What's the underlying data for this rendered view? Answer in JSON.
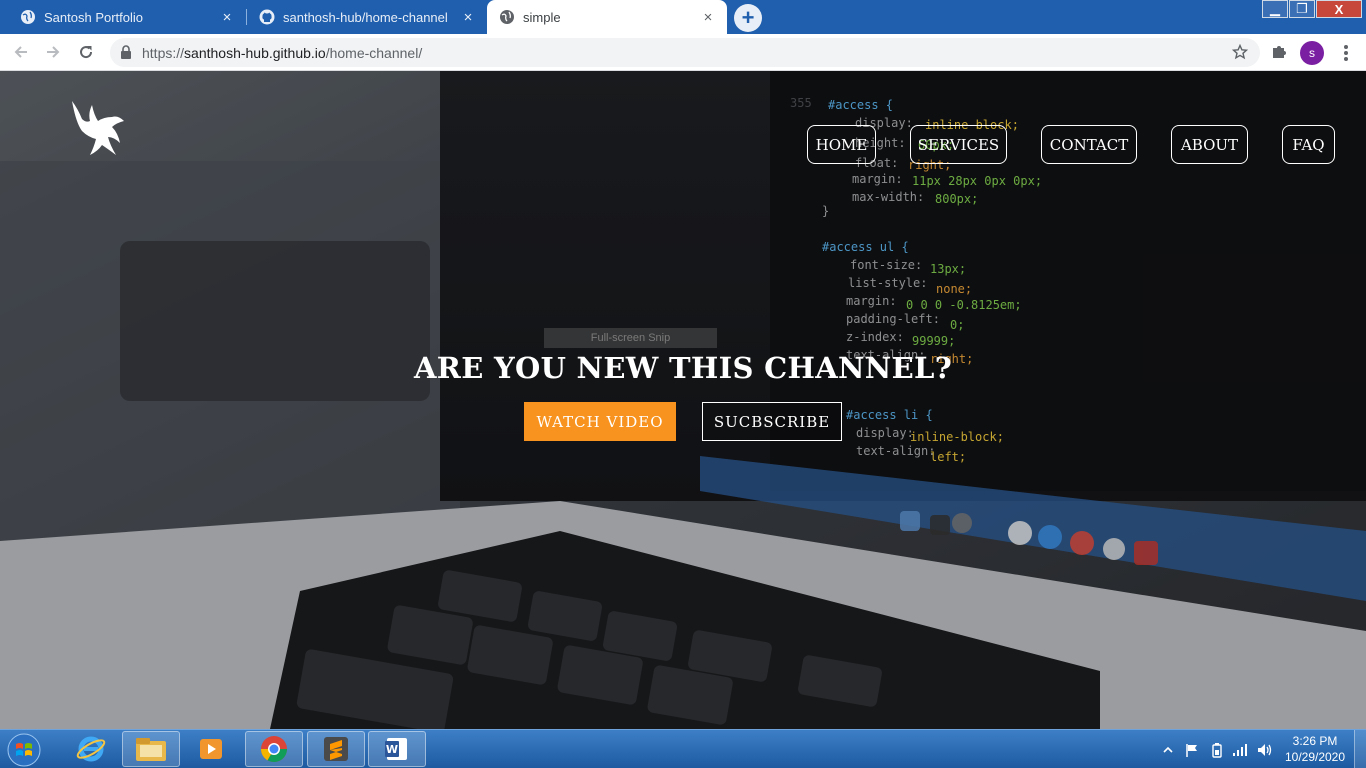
{
  "browser": {
    "tabs": [
      {
        "title": "Santosh Portfolio",
        "icon": "globe-icon",
        "close": "×"
      },
      {
        "title": "santhosh-hub/home-channel",
        "icon": "github-icon",
        "close": "×"
      },
      {
        "title": "simple",
        "icon": "globe-icon",
        "close": "×"
      }
    ],
    "new_tab": "+",
    "window_controls": {
      "minimize": "▁",
      "maximize": "❐",
      "close": "X"
    },
    "url_prefix": "https://",
    "url_host": "santhosh-hub.github.io",
    "url_path": "/home-channel/",
    "profile_initial": "s"
  },
  "page": {
    "nav": [
      "HOME",
      "SERVICES",
      "CONTACT",
      "ABOUT",
      "FAQ"
    ],
    "snip_tooltip": "Full-screen Snip",
    "headline": "ARE YOU NEW THIS CHANNEL?",
    "primary_button": "WATCH VIDEO",
    "secondary_button": "SUCBSCRIBE",
    "accent_color": "#f7931e"
  },
  "taskbar": {
    "apps": [
      "windows-start",
      "internet-explorer",
      "file-explorer",
      "media-player",
      "chrome",
      "sublime-text",
      "word"
    ],
    "clock_time": "3:26 PM",
    "clock_date": "10/29/2020"
  }
}
